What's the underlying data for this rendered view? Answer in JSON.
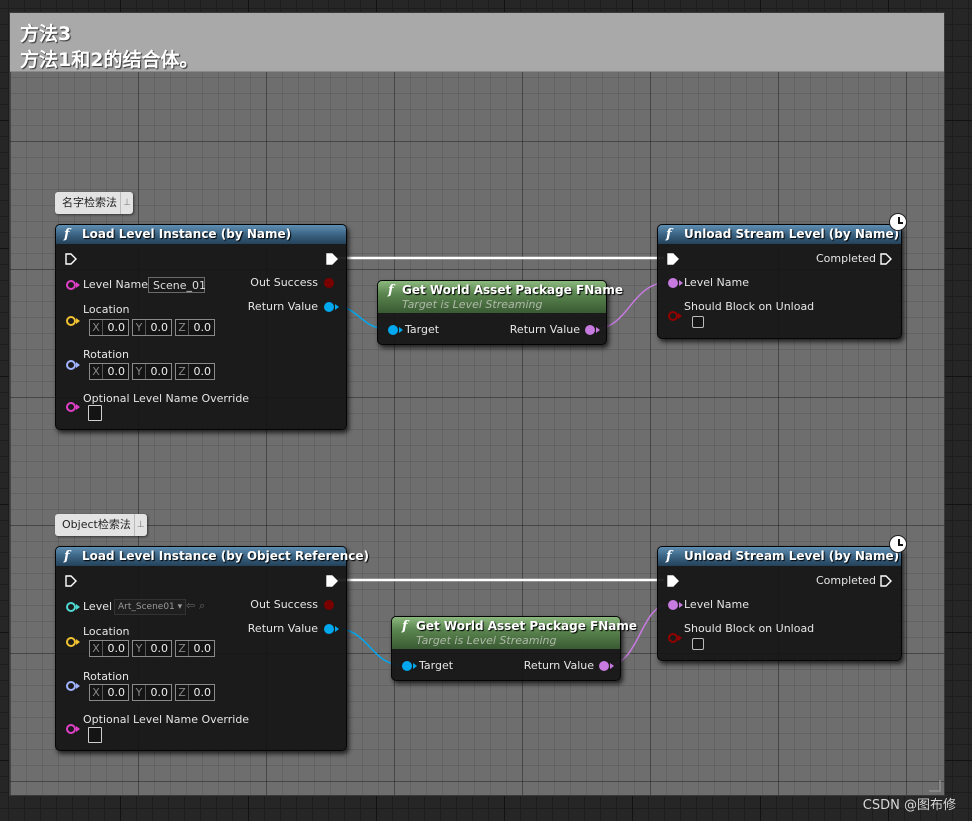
{
  "comment": {
    "title_line1": "方法3",
    "title_line2": "方法1和2的结合体。"
  },
  "group1": {
    "bubble": "名字检索法",
    "load_node": {
      "title": "Load Level Instance (by Name)",
      "level_label": "Level Name",
      "level_value": "Scene_01",
      "location_label": "Location",
      "location": {
        "x": "0.0",
        "y": "0.0",
        "z": "0.0"
      },
      "rotation_label": "Rotation",
      "rotation": {
        "x": "0.0",
        "y": "0.0",
        "z": "0.0"
      },
      "override_label": "Optional Level Name Override",
      "out_success": "Out Success",
      "return_value": "Return Value"
    },
    "get_node": {
      "title": "Get World Asset Package FName",
      "subtitle": "Target is Level Streaming",
      "target": "Target",
      "return_value": "Return Value"
    },
    "unload_node": {
      "title": "Unload Stream Level (by Name)",
      "completed": "Completed",
      "level_name": "Level Name",
      "should_block": "Should Block on Unload"
    }
  },
  "group2": {
    "bubble": "Object检索法",
    "load_node": {
      "title": "Load Level Instance (by Object Reference)",
      "level_label": "Level",
      "level_value": "Art_Scene01",
      "location_label": "Location",
      "location": {
        "x": "0.0",
        "y": "0.0",
        "z": "0.0"
      },
      "rotation_label": "Rotation",
      "rotation": {
        "x": "0.0",
        "y": "0.0",
        "z": "0.0"
      },
      "override_label": "Optional Level Name Override",
      "out_success": "Out Success",
      "return_value": "Return Value"
    },
    "get_node": {
      "title": "Get World Asset Package FName",
      "subtitle": "Target is Level Streaming",
      "target": "Target",
      "return_value": "Return Value"
    },
    "unload_node": {
      "title": "Unload Stream Level (by Name)",
      "completed": "Completed",
      "level_name": "Level Name",
      "should_block": "Should Block on Unload"
    }
  },
  "axis_labels": {
    "x": "X",
    "y": "Y",
    "z": "Z"
  },
  "function_glyph": "f",
  "watermark": "CSDN @图布修",
  "colors": {
    "exec_wire": "#ffffff",
    "object_wire": "#00a8f0",
    "name_wire": "#c77ae0",
    "vector_pin": "#f1c232",
    "rotator_pin": "#a0b4ff",
    "string_pin": "#e040c8",
    "bool_pin": "#930000",
    "soft_object_pin": "#4ed8d0"
  }
}
